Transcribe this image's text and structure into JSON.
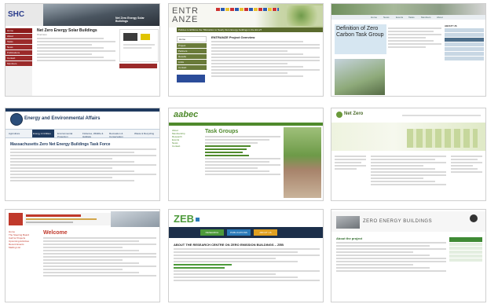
{
  "tiles": {
    "shc": {
      "logo": "SHC",
      "banner": "Net Zero Energy Solar Buildings",
      "title": "Net Zero Energy Solar Buildings",
      "subtitle": "Overview",
      "nav": [
        "Home",
        "About",
        "Tasks",
        "News",
        "Publications",
        "Contact",
        "Members"
      ]
    },
    "entranze": {
      "logo": "ENTRANZE",
      "tagline": "Policies to ENforce the TRAnsition to Nearly Zero Energy buildings in the EU-27",
      "heading": "ENTRANZE Project Overview",
      "nav": [
        "Home",
        "Project",
        "Partners",
        "Results",
        "Links",
        "Contact"
      ]
    },
    "zerocarbon": {
      "heading": "Definition of Zero Carbon Task Group",
      "nav": [
        "Home",
        "News",
        "Events",
        "Tasks",
        "Members",
        "About"
      ],
      "side_title": "ABOUT US"
    },
    "massachusetts": {
      "header": "Energy and Environmental Affairs",
      "heading": "Massachusetts Zero Net Energy Buildings Task Force",
      "nav": [
        "Agriculture",
        "Energy & Utilities",
        "Environmental Protection",
        "Fisheries, Wildlife & Habitats",
        "Recreation & Conservation",
        "Waste & Recycling"
      ]
    },
    "aabec": {
      "logo": "aabec",
      "heading": "Task Groups",
      "side": [
        "About",
        "Membership",
        "Research",
        "Events",
        "News",
        "Contact"
      ]
    },
    "netzero": {
      "logo": "Net Zero"
    },
    "nezeb": {
      "heading": "Welcome",
      "side": [
        "Home",
        "The Steering Board",
        "Call for Projects",
        "Upcoming Activities",
        "Recent Events",
        "Mailing List"
      ]
    },
    "zeb": {
      "logo": "ZEB",
      "heading": "ABOUT THE RESEARCH CENTRE ON ZERO EMISSION BUILDINGS – ZEB",
      "buttons": [
        "RESEARCH",
        "PUBLICATIONS",
        "ABOUT US"
      ]
    },
    "zeroenergy": {
      "logo": "ZERO ENERGY BUILDINGS",
      "heading": "About the project"
    }
  }
}
